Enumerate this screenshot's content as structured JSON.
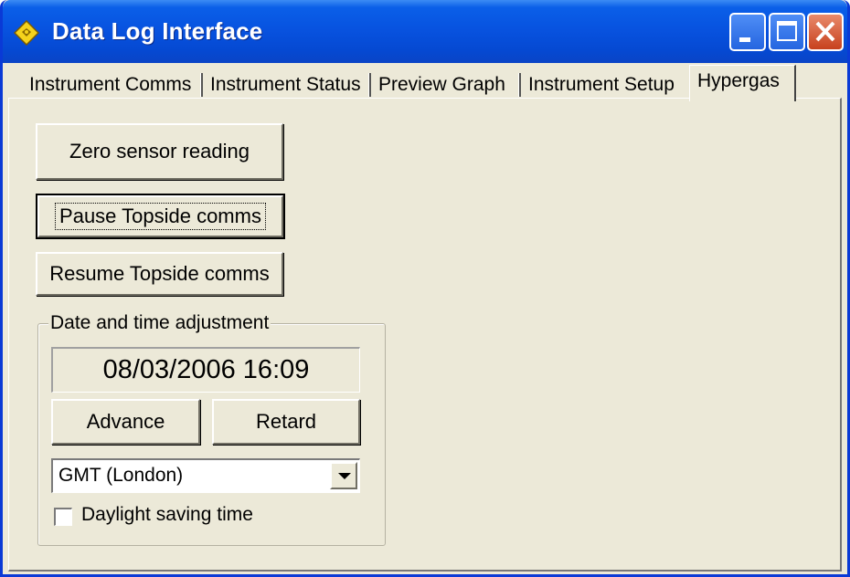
{
  "window": {
    "title": "Data Log Interface",
    "icon": "app-diamond-icon"
  },
  "colors": {
    "titlebar": "#0853e0",
    "face": "#ece9d8",
    "close_button": "#c7411e"
  },
  "tabs": [
    {
      "label": "Instrument Comms",
      "active": false
    },
    {
      "label": "Instrument Status",
      "active": false
    },
    {
      "label": "Preview Graph",
      "active": false
    },
    {
      "label": "Instrument Setup",
      "active": false
    },
    {
      "label": "Hypergas",
      "active": true
    }
  ],
  "hypergas": {
    "zero_label": "Zero sensor reading",
    "pause_label": "Pause Topside comms",
    "resume_label": "Resume Topside comms",
    "group_label": "Date and time adjustment",
    "datetime": "08/03/2006 16:09",
    "advance_label": "Advance",
    "retard_label": "Retard",
    "timezone": "GMT (London)",
    "dst_label": "Daylight saving time",
    "dst_checked": false
  }
}
